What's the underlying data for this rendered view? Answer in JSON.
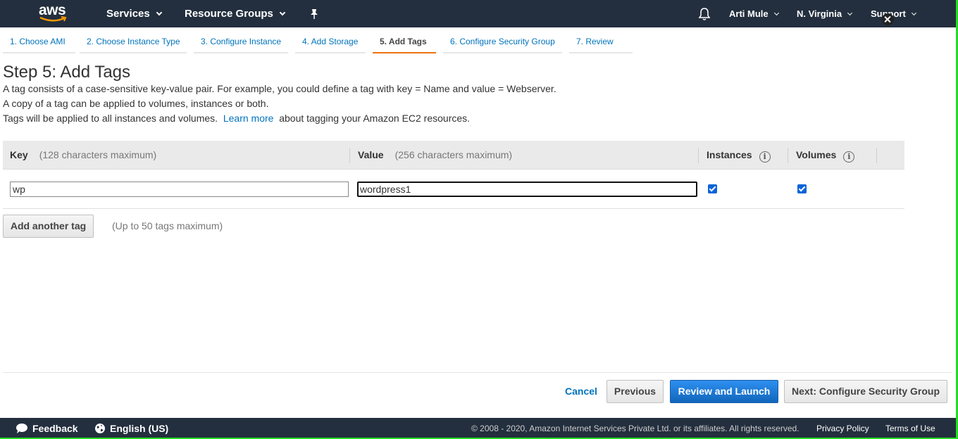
{
  "nav": {
    "logo": "aws",
    "services": "Services",
    "resource_groups": "Resource Groups",
    "user": "Arti Mule",
    "region": "N. Virginia",
    "support": "Support"
  },
  "steps": [
    {
      "label": "1. Choose AMI"
    },
    {
      "label": "2. Choose Instance Type"
    },
    {
      "label": "3. Configure Instance"
    },
    {
      "label": "4. Add Storage"
    },
    {
      "label": "5. Add Tags"
    },
    {
      "label": "6. Configure Security Group"
    },
    {
      "label": "7. Review"
    }
  ],
  "page": {
    "title": "Step 5: Add Tags",
    "desc1": "A tag consists of a case-sensitive key-value pair. For example, you could define a tag with key = Name and value = Webserver.",
    "desc2": "A copy of a tag can be applied to volumes, instances or both.",
    "desc3_pre": "Tags will be applied to all instances and volumes.",
    "desc3_link": "Learn more",
    "desc3_post": "about tagging your Amazon EC2 resources."
  },
  "table": {
    "key_header": "Key",
    "key_sub": "(128 characters maximum)",
    "value_header": "Value",
    "value_sub": "(256 characters maximum)",
    "instances_header": "Instances",
    "volumes_header": "Volumes",
    "rows": [
      {
        "key": "wp",
        "value": "wordpress1",
        "instances": true,
        "volumes": true
      }
    ]
  },
  "add_tag": {
    "button": "Add another tag",
    "hint": "(Up to 50 tags maximum)"
  },
  "actions": {
    "cancel": "Cancel",
    "previous": "Previous",
    "review": "Review and Launch",
    "next": "Next: Configure Security Group"
  },
  "footer": {
    "feedback": "Feedback",
    "language": "English (US)",
    "copyright": "© 2008 - 2020, Amazon Internet Services Private Ltd. or its affiliates. All rights reserved.",
    "privacy": "Privacy Policy",
    "terms": "Terms of Use"
  },
  "colors": {
    "nav_bg": "#232f3e",
    "link": "#0073bb",
    "active_tab": "#ec7211",
    "primary_button": "#1a73d9"
  }
}
